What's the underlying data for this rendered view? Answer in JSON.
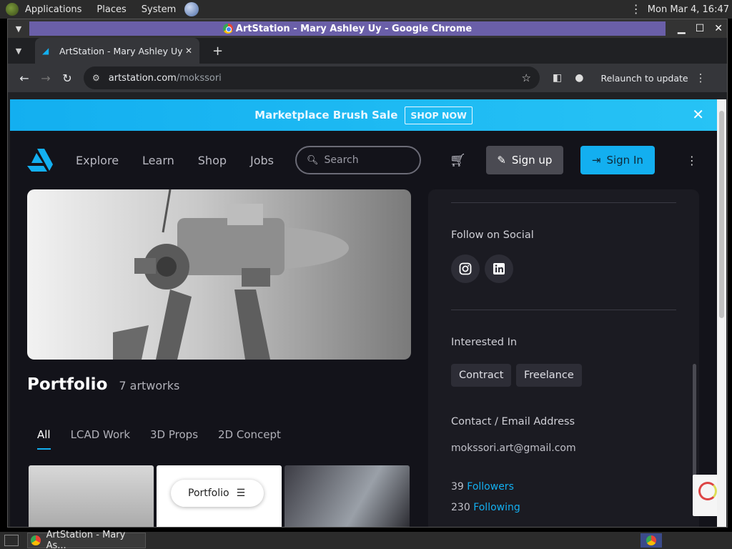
{
  "top_panel": {
    "applications": "Applications",
    "places": "Places",
    "system": "System",
    "datetime": "Mon Mar  4, 16:47"
  },
  "window": {
    "title": "ArtStation - Mary Ashley Uy - Google Chrome"
  },
  "tab": {
    "title": "ArtStation - Mary Ashley Uy"
  },
  "toolbar": {
    "url_host": "artstation.com",
    "url_path": "/mokssori",
    "relaunch": "Relaunch to update"
  },
  "banner": {
    "text": "Marketplace Brush Sale",
    "cta": "SHOP NOW"
  },
  "nav": {
    "links": [
      "Explore",
      "Learn",
      "Shop",
      "Jobs"
    ],
    "search_placeholder": "Search",
    "signup": "Sign up",
    "signin": "Sign In"
  },
  "portfolio": {
    "heading": "Portfolio",
    "count": "7 artworks",
    "filters": [
      "All",
      "LCAD Work",
      "3D Props",
      "2D Concept"
    ],
    "pill": "Portfolio"
  },
  "about": {
    "follow_label": "Follow on Social",
    "interested_label": "Interested In",
    "chips": [
      "Contract",
      "Freelance"
    ],
    "contact_label": "Contact / Email Address",
    "email": "mokssori.art@gmail.com",
    "followers_count": "39",
    "followers_label": "Followers",
    "following_count": "230",
    "following_label": "Following"
  },
  "taskbar": {
    "task_title": "ArtStation - Mary As..."
  },
  "colors": {
    "accent": "#13aff0",
    "page_bg": "#13131a",
    "panel_bg": "#1b1b22"
  }
}
